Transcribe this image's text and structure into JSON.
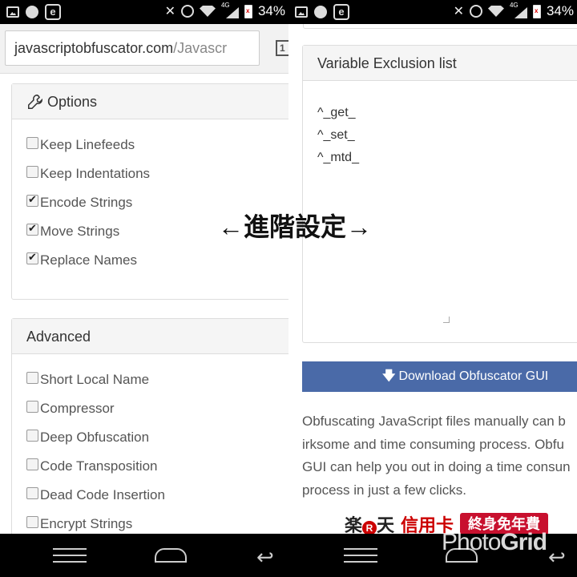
{
  "left_screen": {
    "status_bar": {
      "battery_percent": "34%",
      "network_type": "4G"
    },
    "browser": {
      "url_host": "javascriptobfuscator.com",
      "url_path": "/Javascr",
      "tab_count": "1"
    },
    "options_panel": {
      "title": "Options",
      "items": [
        {
          "label": "Keep Linefeeds",
          "checked": false
        },
        {
          "label": "Keep Indentations",
          "checked": false
        },
        {
          "label": "Encode Strings",
          "checked": true
        },
        {
          "label": "Move Strings",
          "checked": true
        },
        {
          "label": "Replace Names",
          "checked": true
        }
      ]
    },
    "advanced_panel": {
      "title": "Advanced",
      "items": [
        {
          "label": "Short Local Name",
          "checked": false
        },
        {
          "label": "Compressor",
          "checked": false
        },
        {
          "label": "Deep Obfuscation",
          "checked": false
        },
        {
          "label": "Code Transposition",
          "checked": false
        },
        {
          "label": "Dead Code Insertion",
          "checked": false
        },
        {
          "label": "Encrypt Strings",
          "checked": false
        }
      ]
    }
  },
  "right_screen": {
    "status_bar": {
      "battery_percent": "34%",
      "network_type": "4G"
    },
    "exclusion_panel": {
      "title": "Variable Exclusion list",
      "lines": [
        "^_get_",
        "^_set_",
        "^_mtd_"
      ]
    },
    "download_button": {
      "label": "Download Obfuscator GUI"
    },
    "description_lines": [
      "Obfuscating JavaScript files manually can b",
      "irksome and time consuming process. Obfu",
      "GUI can help you out in doing a time consun",
      "process in just a few clicks."
    ],
    "ad": {
      "brand": "楽",
      "r_mark": "R",
      "brand2": "天",
      "product": "信用卡",
      "banner": "終身免年費"
    }
  },
  "overlay_label": "←進階設定→",
  "watermark": {
    "part1": "Photo",
    "part2": "Grid"
  },
  "colors": {
    "download_button": "#4a6aa8",
    "panel_header_bg": "#f5f5f5",
    "ad_red": "#c8102e"
  }
}
